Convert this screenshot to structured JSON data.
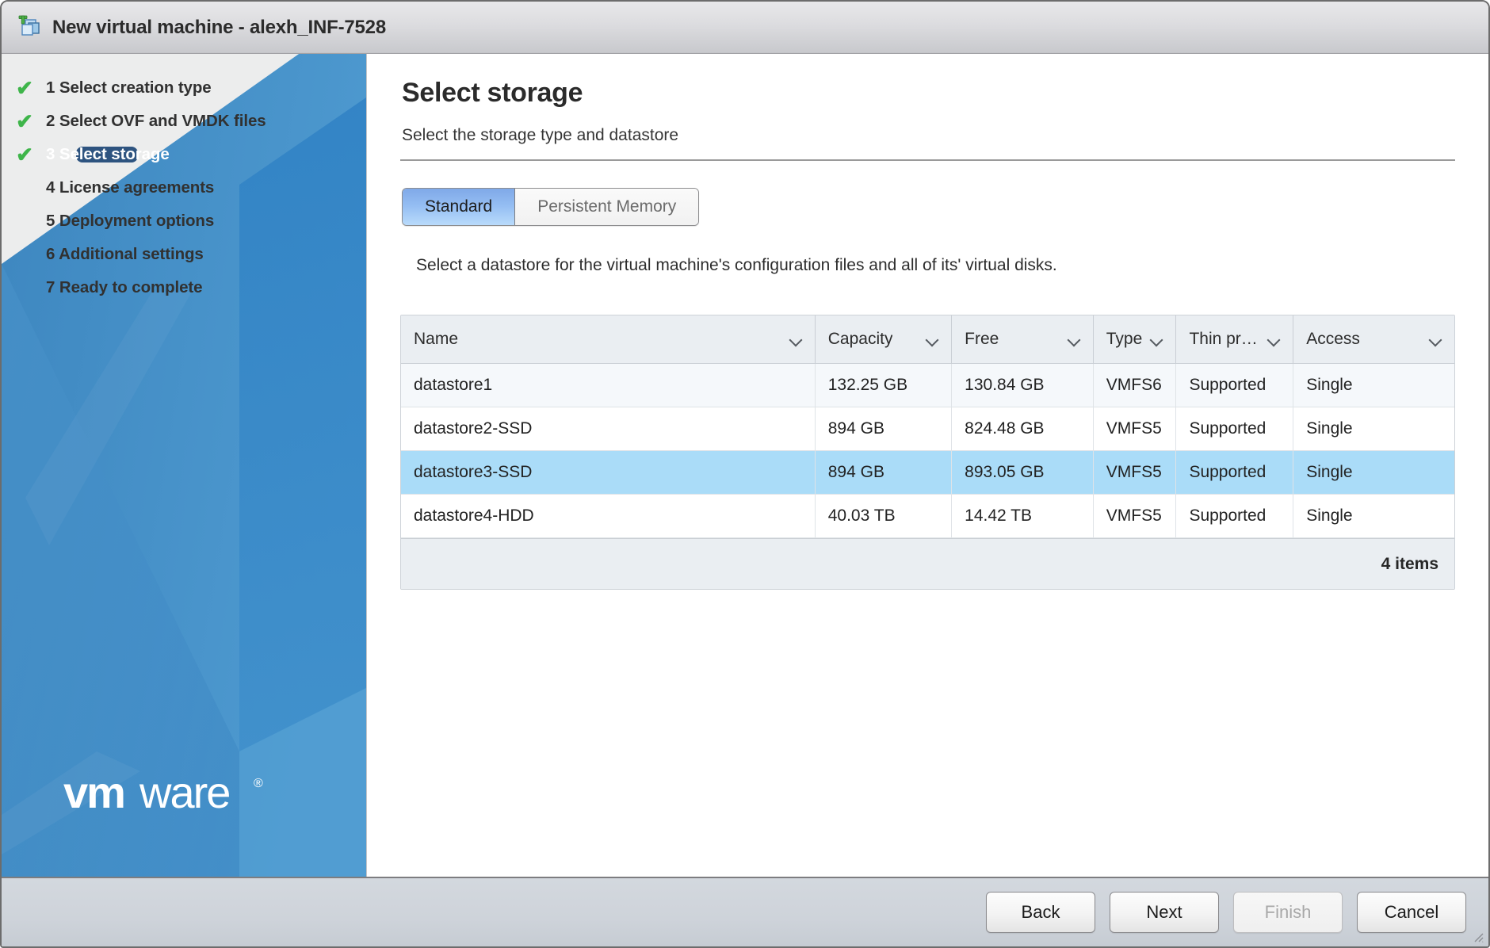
{
  "window": {
    "title": "New virtual machine - alexh_INF-7528",
    "title_icon": "new-vm-icon"
  },
  "sidebar": {
    "steps": [
      {
        "number": "1",
        "label": "1 Select creation type",
        "completed": true,
        "active": false
      },
      {
        "number": "2",
        "label": "2 Select OVF and VMDK files",
        "completed": true,
        "active": false
      },
      {
        "number": "3",
        "label": "3 Select storage",
        "completed": true,
        "active": true
      },
      {
        "number": "4",
        "label": "4 License agreements",
        "completed": false,
        "active": false
      },
      {
        "number": "5",
        "label": "5 Deployment options",
        "completed": false,
        "active": false
      },
      {
        "number": "6",
        "label": "6 Additional settings",
        "completed": false,
        "active": false
      },
      {
        "number": "7",
        "label": "7 Ready to complete",
        "completed": false,
        "active": false
      }
    ],
    "check_glyph": "✔",
    "logo_text": "vmware",
    "logo_mark": "®",
    "colors": {
      "background": "#eceded",
      "active_pill": "#2e5480",
      "check": "#3eb54a",
      "art_blue_light": "#4a90c8",
      "art_blue_mid": "#3b86c4",
      "art_blue_dark": "#2f82c4"
    }
  },
  "main": {
    "page_title": "Select storage",
    "page_subtitle": "Select the storage type and datastore",
    "tabs": [
      {
        "label": "Standard",
        "selected": true
      },
      {
        "label": "Persistent Memory",
        "selected": false
      }
    ],
    "instruction": "Select a datastore for the virtual machine's configuration files and all of its' virtual disks.",
    "table": {
      "columns": [
        {
          "label": "Name",
          "sortable": true
        },
        {
          "label": "Capacity",
          "sortable": true
        },
        {
          "label": "Free",
          "sortable": true
        },
        {
          "label": "Type",
          "sortable": true
        },
        {
          "label": "Thin pro...",
          "sortable": true
        },
        {
          "label": "Access",
          "sortable": true
        }
      ],
      "rows": [
        {
          "name": "datastore1",
          "capacity": "132.25 GB",
          "free": "130.84 GB",
          "type": "VMFS6",
          "thin": "Supported",
          "access": "Single",
          "selected": false
        },
        {
          "name": "datastore2-SSD",
          "capacity": "894 GB",
          "free": "824.48 GB",
          "type": "VMFS5",
          "thin": "Supported",
          "access": "Single",
          "selected": false
        },
        {
          "name": "datastore3-SSD",
          "capacity": "894 GB",
          "free": "893.05 GB",
          "type": "VMFS5",
          "thin": "Supported",
          "access": "Single",
          "selected": true
        },
        {
          "name": "datastore4-HDD",
          "capacity": "40.03 TB",
          "free": "14.42 TB",
          "type": "VMFS5",
          "thin": "Supported",
          "access": "Single",
          "selected": false
        }
      ],
      "footer_count": "4 items",
      "selection_color": "#aadcf8"
    }
  },
  "footer": {
    "buttons": [
      {
        "label": "Back",
        "disabled": false
      },
      {
        "label": "Next",
        "disabled": false
      },
      {
        "label": "Finish",
        "disabled": true
      },
      {
        "label": "Cancel",
        "disabled": false
      }
    ]
  }
}
